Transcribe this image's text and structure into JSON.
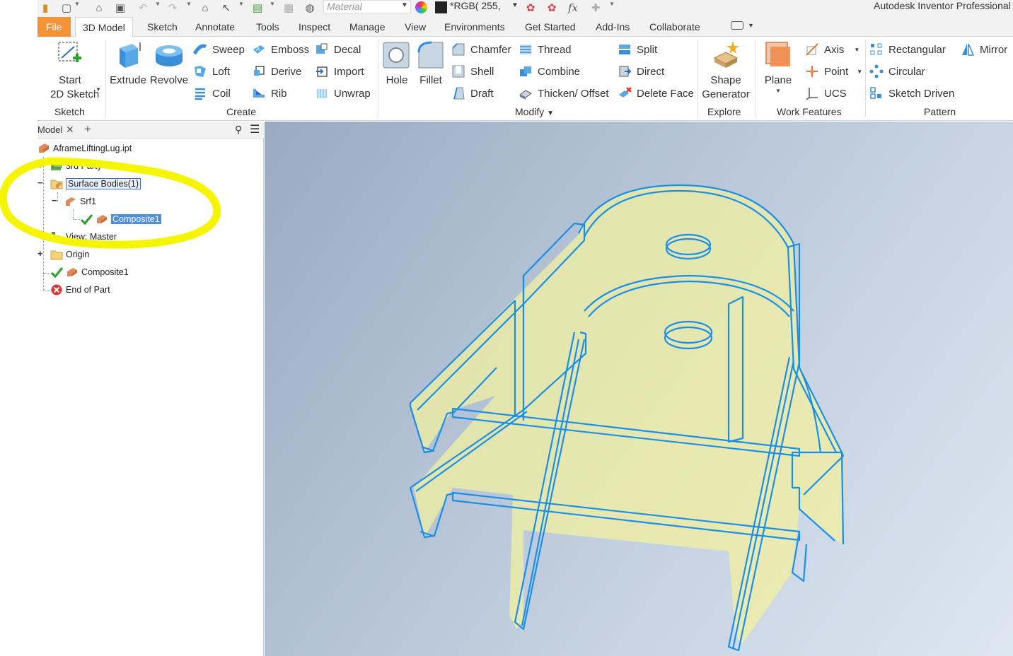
{
  "quick_access": {
    "material_placeholder": "Material",
    "appearance_value": "*RGB( 255,",
    "fx_label": "fx",
    "app_title": "Autodesk Inventor Professional"
  },
  "tabs": [
    {
      "label": "File"
    },
    {
      "label": "3D Model"
    },
    {
      "label": "Sketch"
    },
    {
      "label": "Annotate"
    },
    {
      "label": "Tools"
    },
    {
      "label": "Inspect"
    },
    {
      "label": "Manage"
    },
    {
      "label": "View"
    },
    {
      "label": "Environments"
    },
    {
      "label": "Get Started"
    },
    {
      "label": "Add-Ins"
    },
    {
      "label": "Collaborate"
    }
  ],
  "ribbon": {
    "sketch": {
      "label": "Sketch",
      "start_line1": "Start",
      "start_line2": "2D Sketch"
    },
    "create": {
      "label": "Create",
      "extrude": "Extrude",
      "revolve": "Revolve",
      "sweep": "Sweep",
      "loft": "Loft",
      "coil": "Coil",
      "emboss": "Emboss",
      "derive": "Derive",
      "rib": "Rib",
      "decal": "Decal",
      "import": "Import",
      "unwrap": "Unwrap"
    },
    "modify": {
      "label": "Modify",
      "hole": "Hole",
      "fillet": "Fillet",
      "chamfer": "Chamfer",
      "shell": "Shell",
      "draft": "Draft",
      "thread": "Thread",
      "combine": "Combine",
      "thicken": "Thicken/ Offset",
      "split": "Split",
      "direct": "Direct",
      "delete_face": "Delete Face"
    },
    "explore": {
      "label": "Explore",
      "shape_line1": "Shape",
      "shape_line2": "Generator"
    },
    "work_features": {
      "label": "Work Features",
      "plane": "Plane",
      "axis": "Axis",
      "point": "Point",
      "ucs": "UCS"
    },
    "pattern": {
      "label": "Pattern",
      "rectangular": "Rectangular",
      "circular": "Circular",
      "sketch_driven": "Sketch Driven",
      "mirror": "Mirror"
    }
  },
  "browser": {
    "tab_label": "Model",
    "tree": {
      "root": "AframeLiftingLug.ipt",
      "third_party": "3rd Party",
      "surface_bodies": "Surface Bodies(1)",
      "srf1": "Srf1",
      "composite_child": "Composite1",
      "view_master": "View: Master",
      "origin": "Origin",
      "composite": "Composite1",
      "end_of_part": "End of Part"
    }
  },
  "colors": {
    "file_tab": "#f39237",
    "highlight_annotation": "#f5f500",
    "wireframe": "#1a8fe8",
    "surface_fill": "#f2f0a0",
    "selection": "#4b8fe2"
  }
}
